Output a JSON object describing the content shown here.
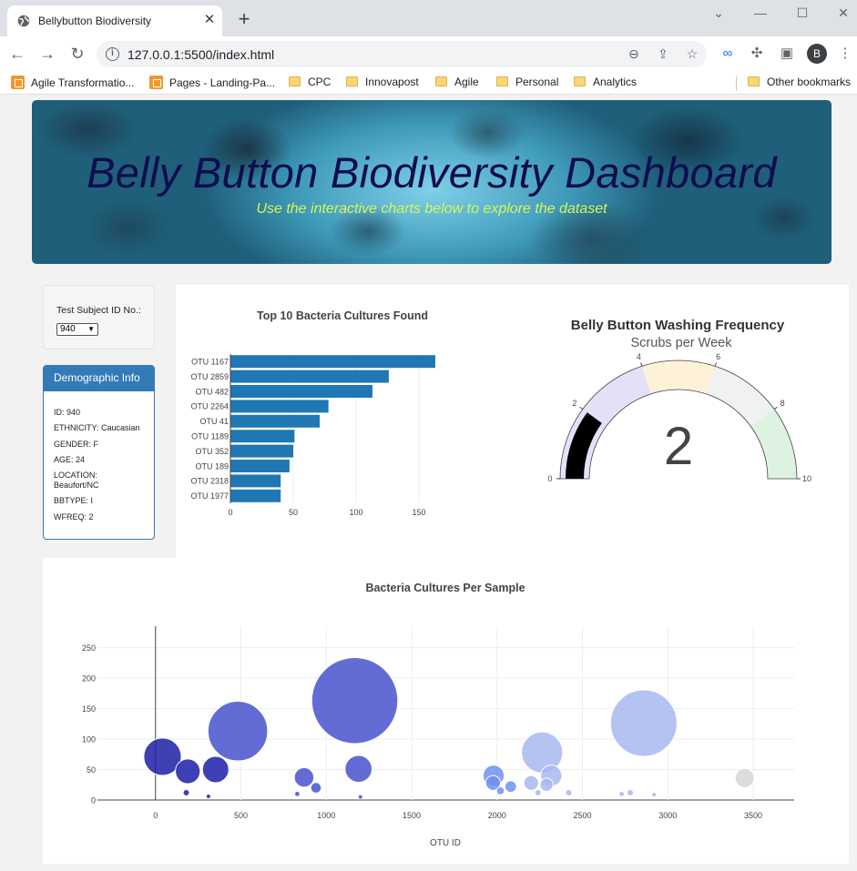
{
  "browser": {
    "tab_title": "Bellybutton Biodiversity",
    "url": "127.0.0.1:5500/index.html",
    "profile_initial": "B",
    "bookmarks": [
      {
        "label": "Agile Transformatio...",
        "icon": "orange-app-icon"
      },
      {
        "label": "Pages - Landing-Pa...",
        "icon": "orange-app-icon"
      },
      {
        "label": "CPC",
        "icon": "folder-icon"
      },
      {
        "label": "Innovapost",
        "icon": "folder-icon"
      },
      {
        "label": "Agile",
        "icon": "folder-icon"
      },
      {
        "label": "Personal",
        "icon": "folder-icon"
      },
      {
        "label": "Analytics",
        "icon": "folder-icon"
      }
    ],
    "other_bookmarks": "Other bookmarks"
  },
  "header": {
    "title": "Belly Button Biodiversity Dashboard",
    "subtitle": "Use the interactive charts below to explore the dataset"
  },
  "selector": {
    "label": "Test Subject ID No.:",
    "selected": "940"
  },
  "demographics": {
    "title": "Demographic Info",
    "lines": [
      "ID: 940",
      "ETHNICITY: Caucasian",
      "GENDER: F",
      "AGE: 24",
      "LOCATION: Beaufort/NC",
      "BBTYPE: I",
      "WFREQ: 2"
    ]
  },
  "chart_data": [
    {
      "type": "bar",
      "orientation": "horizontal",
      "title": "Top 10 Bacteria Cultures Found",
      "categories": [
        "OTU 1167",
        "OTU 2859",
        "OTU 482",
        "OTU 2264",
        "OTU 41",
        "OTU 1189",
        "OTU 352",
        "OTU 189",
        "OTU 2318",
        "OTU 1977"
      ],
      "values": [
        163,
        126,
        113,
        78,
        71,
        51,
        50,
        47,
        40,
        40
      ],
      "xticks": [
        0,
        50,
        100,
        150
      ],
      "xlim": [
        0,
        171
      ],
      "color": "#1f77b4"
    },
    {
      "type": "gauge",
      "title": "Belly Button Washing Frequency",
      "subtitle": "Scrubs per Week",
      "value": 2,
      "range": [
        0,
        10
      ],
      "ticks": [
        0,
        2,
        4,
        6,
        8,
        10
      ],
      "steps": [
        {
          "range": [
            0,
            2
          ],
          "color": "#e6e1fa"
        },
        {
          "range": [
            2,
            4
          ],
          "color": "#e3e1f7"
        },
        {
          "range": [
            4,
            6
          ],
          "color": "#fdf2d8"
        },
        {
          "range": [
            6,
            8
          ],
          "color": "#f0f1f3"
        },
        {
          "range": [
            8,
            10
          ],
          "color": "#ddf2e1"
        }
      ],
      "bar_color": "#000000"
    },
    {
      "type": "scatter",
      "style": "bubble",
      "title": "Bacteria Cultures Per Sample",
      "xlabel": "OTU ID",
      "xticks": [
        0,
        500,
        1000,
        1500,
        2000,
        2500,
        3000,
        3500
      ],
      "yticks": [
        0,
        50,
        100,
        150,
        200,
        250
      ],
      "xlim": [
        -340,
        3740
      ],
      "ylim": [
        0,
        285
      ],
      "points": [
        {
          "x": 41,
          "y": 71
        },
        {
          "x": 189,
          "y": 47
        },
        {
          "x": 352,
          "y": 50
        },
        {
          "x": 482,
          "y": 113
        },
        {
          "x": 180,
          "y": 12
        },
        {
          "x": 310,
          "y": 6
        },
        {
          "x": 870,
          "y": 37
        },
        {
          "x": 940,
          "y": 20
        },
        {
          "x": 830,
          "y": 10
        },
        {
          "x": 1167,
          "y": 163
        },
        {
          "x": 1189,
          "y": 51
        },
        {
          "x": 1200,
          "y": 5
        },
        {
          "x": 1980,
          "y": 40
        },
        {
          "x": 1977,
          "y": 28
        },
        {
          "x": 2080,
          "y": 22
        },
        {
          "x": 2020,
          "y": 15
        },
        {
          "x": 2264,
          "y": 78
        },
        {
          "x": 2200,
          "y": 28
        },
        {
          "x": 2318,
          "y": 40
        },
        {
          "x": 2290,
          "y": 25
        },
        {
          "x": 2240,
          "y": 12
        },
        {
          "x": 2420,
          "y": 12
        },
        {
          "x": 2859,
          "y": 126
        },
        {
          "x": 2780,
          "y": 12
        },
        {
          "x": 2730,
          "y": 10
        },
        {
          "x": 2920,
          "y": 9
        },
        {
          "x": 3450,
          "y": 36
        }
      ],
      "colorscale": [
        "#1c1ea6",
        "#4852cc",
        "#6f90f0",
        "#a8b8f0",
        "#d6d6d6"
      ]
    }
  ]
}
